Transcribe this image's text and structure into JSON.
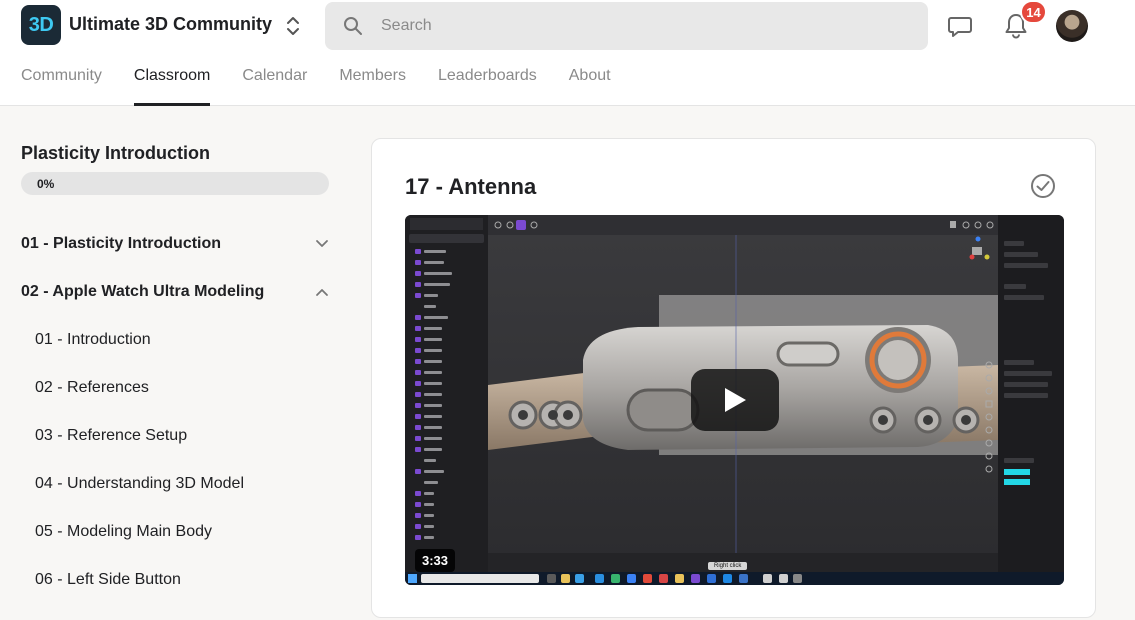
{
  "header": {
    "logo_text": "3D",
    "community_name": "Ultimate 3D Community",
    "search_placeholder": "Search",
    "notification_count": "14"
  },
  "nav": {
    "tabs": [
      {
        "label": "Community",
        "active": false
      },
      {
        "label": "Classroom",
        "active": true
      },
      {
        "label": "Calendar",
        "active": false
      },
      {
        "label": "Members",
        "active": false
      },
      {
        "label": "Leaderboards",
        "active": false
      },
      {
        "label": "About",
        "active": false
      }
    ]
  },
  "sidebar": {
    "course_title": "Plasticity Introduction",
    "progress_text": "0%",
    "progress_value": 0,
    "modules": [
      {
        "label": "01 - Plasticity Introduction",
        "expanded": false
      },
      {
        "label": "02 - Apple Watch Ultra Modeling",
        "expanded": true
      }
    ],
    "lessons": [
      {
        "label": "01 - Introduction"
      },
      {
        "label": "02 - References"
      },
      {
        "label": "03 - Reference Setup"
      },
      {
        "label": "04 - Understanding 3D Model"
      },
      {
        "label": "05 - Modeling Main Body"
      },
      {
        "label": "06 - Left Side Button"
      }
    ]
  },
  "content": {
    "lesson_title": "17 - Antenna",
    "video": {
      "duration": "3:33",
      "overlay_hint": "Right click"
    }
  },
  "colors": {
    "accent_logo": "#3ec9f2",
    "badge": "#e5483c",
    "active_tab": "#202124",
    "muted_text": "#8a8a8a"
  },
  "icons": {
    "switcher": "chevron-up-down-icon",
    "search": "search-icon",
    "chat": "chat-bubble-icon",
    "notifications": "bell-icon",
    "module_collapsed": "chevron-down-icon",
    "module_expanded": "chevron-up-icon",
    "completion": "check-circle-icon",
    "play": "play-icon"
  }
}
